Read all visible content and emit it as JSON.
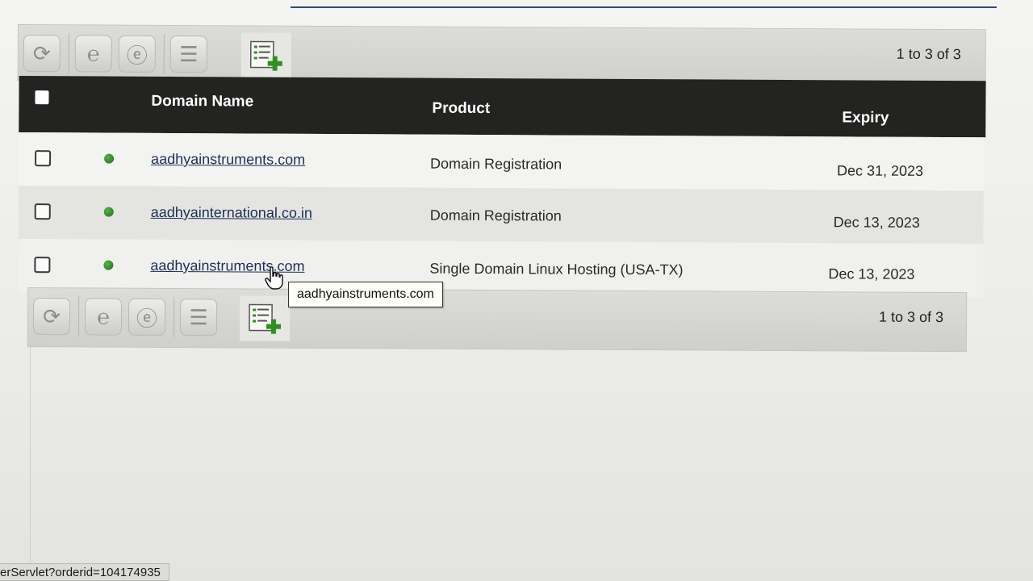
{
  "toolbar": {
    "pagination": "1 to 3 of 3",
    "buttons": [
      {
        "name": "refresh-icon",
        "glyph": "⟳"
      },
      {
        "name": "renew-icon",
        "glyph": "℮"
      },
      {
        "name": "transfer-icon",
        "glyph": "ⓔ"
      },
      {
        "name": "edit-list-icon",
        "glyph": "☰"
      }
    ],
    "add_icon": "add-list-icon"
  },
  "table": {
    "columns": {
      "domain": "Domain Name",
      "product": "Product",
      "expiry": "Expiry"
    },
    "rows": [
      {
        "domain": "aadhyainstruments.com",
        "product": "Domain Registration",
        "expiry": "Dec 31, 2023",
        "status": "active"
      },
      {
        "domain": "aadhyainternational.co.in",
        "product": "Domain Registration",
        "expiry": "Dec 13, 2023",
        "status": "active"
      },
      {
        "domain": "aadhyainstruments.com",
        "product": "Single Domain Linux Hosting (USA-TX)",
        "expiry": "Dec 13, 2023",
        "status": "active"
      }
    ]
  },
  "tooltip": {
    "text": "aadhyainstruments.com"
  },
  "status_bar": {
    "text": "erServlet?orderid=104174935"
  },
  "colors": {
    "header_bg": "#232321",
    "status_active": "#2e8a25",
    "link": "#1f2f57"
  }
}
